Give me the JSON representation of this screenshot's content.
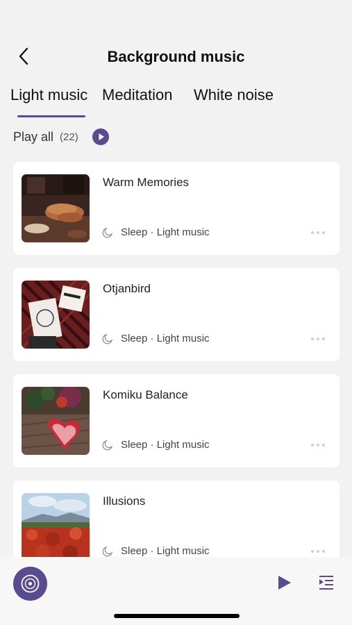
{
  "header": {
    "title": "Background music",
    "back_icon": "chevron-left-icon"
  },
  "tabs": [
    {
      "label": "Light music",
      "active": true
    },
    {
      "label": "Meditation",
      "active": false
    },
    {
      "label": "White noise",
      "active": false
    }
  ],
  "play_all": {
    "label": "Play all",
    "count": "(22)",
    "icon": "play-circle-icon"
  },
  "tracks": [
    {
      "title": "Warm Memories",
      "tag": "Sleep · Light music"
    },
    {
      "title": "Otjanbird",
      "tag": "Sleep · Light music"
    },
    {
      "title": "Komiku Balance",
      "tag": "Sleep · Light music"
    },
    {
      "title": "Illusions",
      "tag": "Sleep · Light music"
    }
  ],
  "player_bar": {
    "disc_icon": "disc-icon",
    "play_icon": "play-icon",
    "playlist_icon": "playlist-icon"
  },
  "colors": {
    "accent": "#5a4b91",
    "background": "#f2f2f2",
    "card": "#ffffff"
  }
}
